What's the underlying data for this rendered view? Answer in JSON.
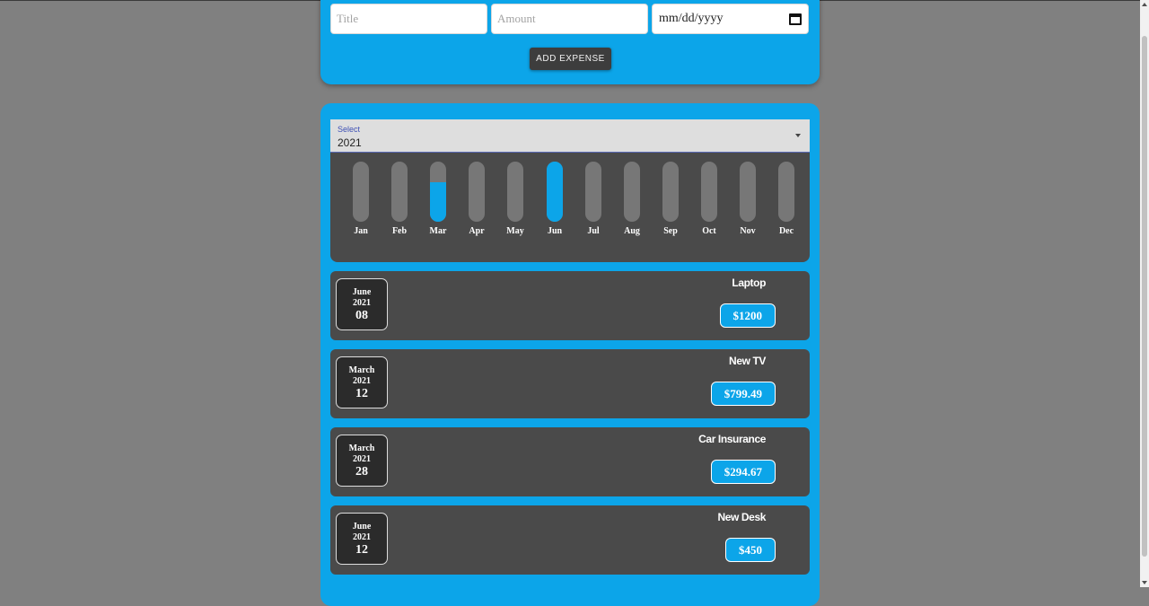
{
  "form": {
    "title_placeholder": "Title",
    "amount_placeholder": "Amount",
    "date_placeholder": "mm/dd/yyyy",
    "add_button": "ADD EXPENSE"
  },
  "filter": {
    "label": "Select",
    "value": "2021"
  },
  "chart_data": {
    "type": "bar",
    "categories": [
      "Jan",
      "Feb",
      "Mar",
      "Apr",
      "May",
      "Jun",
      "Jul",
      "Aug",
      "Sep",
      "Oct",
      "Nov",
      "Dec"
    ],
    "values": [
      0,
      0,
      1094.16,
      0,
      0,
      1650,
      0,
      0,
      0,
      0,
      0,
      0
    ],
    "ylim": [
      0,
      1650
    ],
    "colors": {
      "fill": "#0ca5e9",
      "track": "#777777"
    }
  },
  "expenses": [
    {
      "month": "June",
      "year": "2021",
      "day": "08",
      "title": "Laptop",
      "amount": "$1200"
    },
    {
      "month": "March",
      "year": "2021",
      "day": "12",
      "title": "New TV",
      "amount": "$799.49"
    },
    {
      "month": "March",
      "year": "2021",
      "day": "28",
      "title": "Car Insurance",
      "amount": "$294.67"
    },
    {
      "month": "June",
      "year": "2021",
      "day": "12",
      "title": "New Desk",
      "amount": "$450"
    }
  ],
  "colors": {
    "background": "#808080",
    "accent": "#0ca5e9",
    "panel": "#4a4a4a",
    "date_box": "#2b2b2b"
  }
}
